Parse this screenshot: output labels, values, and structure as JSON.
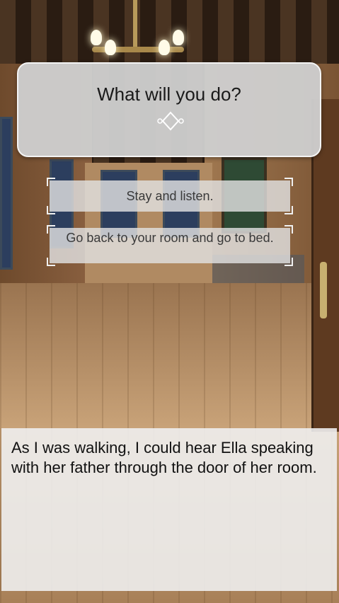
{
  "question": {
    "text": "What will you do?"
  },
  "choices": [
    {
      "label": "Stay and listen."
    },
    {
      "label": "Go back to your room and go to bed."
    }
  ],
  "dialogue": {
    "text": "As I was walking, I could hear Ella speaking with her father through the door of her room."
  },
  "icons": {
    "divider": "diamond-divider-icon",
    "chandelier": "chandelier-icon"
  },
  "colors": {
    "panel": "#cecece",
    "panel_border": "#f4f4f4",
    "choice_bg": "#e1e1e1",
    "dialogue_bg": "#eeeeee"
  }
}
